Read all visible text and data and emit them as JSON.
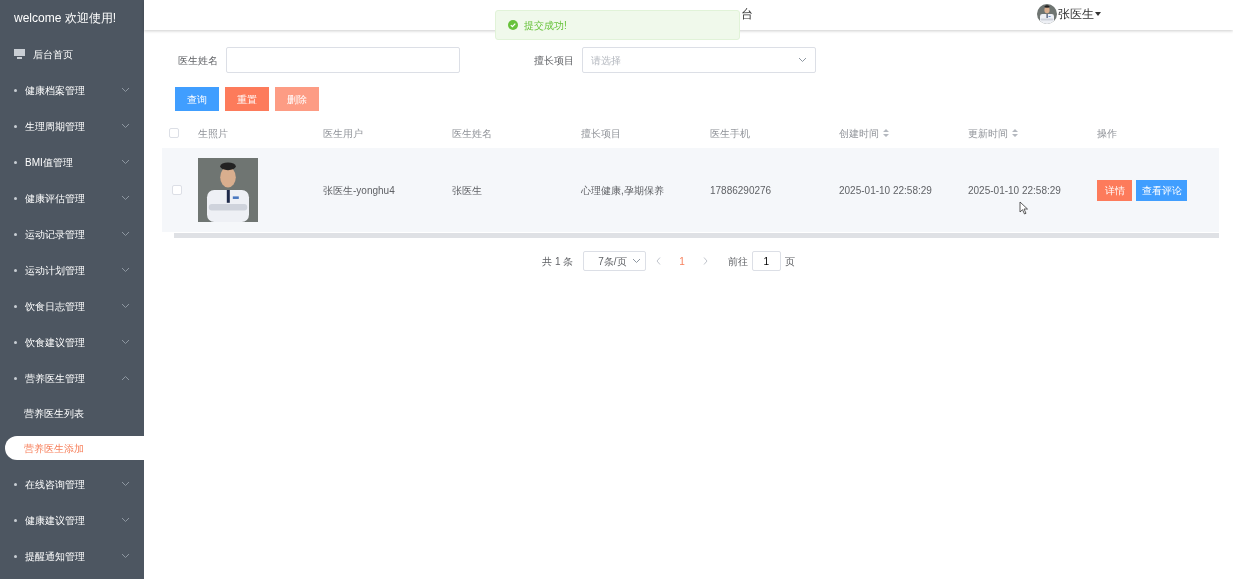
{
  "sidebar": {
    "title": "welcome 欢迎使用!",
    "items": [
      {
        "label": "后台首页",
        "kind": "home"
      },
      {
        "label": "健康档案管理",
        "kind": "menu",
        "expanded": false
      },
      {
        "label": "生理周期管理",
        "kind": "menu",
        "expanded": false
      },
      {
        "label": "BMI值管理",
        "kind": "menu",
        "expanded": false
      },
      {
        "label": "健康评估管理",
        "kind": "menu",
        "expanded": false
      },
      {
        "label": "运动记录管理",
        "kind": "menu",
        "expanded": false
      },
      {
        "label": "运动计划管理",
        "kind": "menu",
        "expanded": false
      },
      {
        "label": "饮食日志管理",
        "kind": "menu",
        "expanded": false
      },
      {
        "label": "饮食建议管理",
        "kind": "menu",
        "expanded": false
      },
      {
        "label": "营养医生管理",
        "kind": "menu",
        "expanded": true,
        "children": [
          {
            "label": "营养医生列表",
            "selected": false
          },
          {
            "label": "营养医生添加",
            "selected": true
          }
        ]
      },
      {
        "label": "在线咨询管理",
        "kind": "menu",
        "expanded": false
      },
      {
        "label": "健康建议管理",
        "kind": "menu",
        "expanded": false
      },
      {
        "label": "提醒通知管理",
        "kind": "menu",
        "expanded": false
      }
    ]
  },
  "header": {
    "title": "台",
    "user": "张医生"
  },
  "toast": {
    "text": "提交成功!"
  },
  "search": {
    "fields": [
      {
        "label": "医生姓名",
        "kind": "text"
      },
      {
        "label": "擅长项目",
        "kind": "select",
        "placeholder": "请选择"
      }
    ],
    "buttons": [
      {
        "label": "查询",
        "kind": "primary",
        "disabled": false
      },
      {
        "label": "重置",
        "kind": "warning",
        "disabled": false
      },
      {
        "label": "删除",
        "kind": "danger",
        "disabled": true
      }
    ]
  },
  "table": {
    "select_all": false,
    "columns": [
      {
        "label": "生照片",
        "sortable": false
      },
      {
        "label": "医生用户",
        "sortable": false
      },
      {
        "label": "医生姓名",
        "sortable": false
      },
      {
        "label": "擅长项目",
        "sortable": false
      },
      {
        "label": "医生手机",
        "sortable": false
      },
      {
        "label": "创建时间",
        "sortable": true
      },
      {
        "label": "更新时间",
        "sortable": true
      },
      {
        "label": "操作",
        "sortable": false
      }
    ],
    "rows": [
      {
        "checked": false,
        "cells": [
          {
            "kind": "picture"
          },
          {
            "kind": "text",
            "text": "张医生-yonghu4"
          },
          {
            "kind": "text",
            "text": "张医生"
          },
          {
            "kind": "text",
            "text": "心理健康,孕期保养"
          },
          {
            "kind": "text",
            "text": "17886290276"
          },
          {
            "kind": "text",
            "text": "2025-01-10 22:58:29"
          },
          {
            "kind": "text",
            "text": "2025-01-10 22:58:29"
          },
          {
            "kind": "actions",
            "actions": [
              {
                "label": "详情",
                "kind": "warning"
              },
              {
                "label": "查看评论",
                "kind": "primary"
              }
            ]
          }
        ]
      }
    ]
  },
  "pagination": {
    "total": "共 1 条",
    "page_size": "7条/页",
    "pages": [
      {
        "label": "1",
        "selected": true
      }
    ],
    "goto_label": "前往",
    "goto_value": "1",
    "goto_suffix": "页"
  }
}
